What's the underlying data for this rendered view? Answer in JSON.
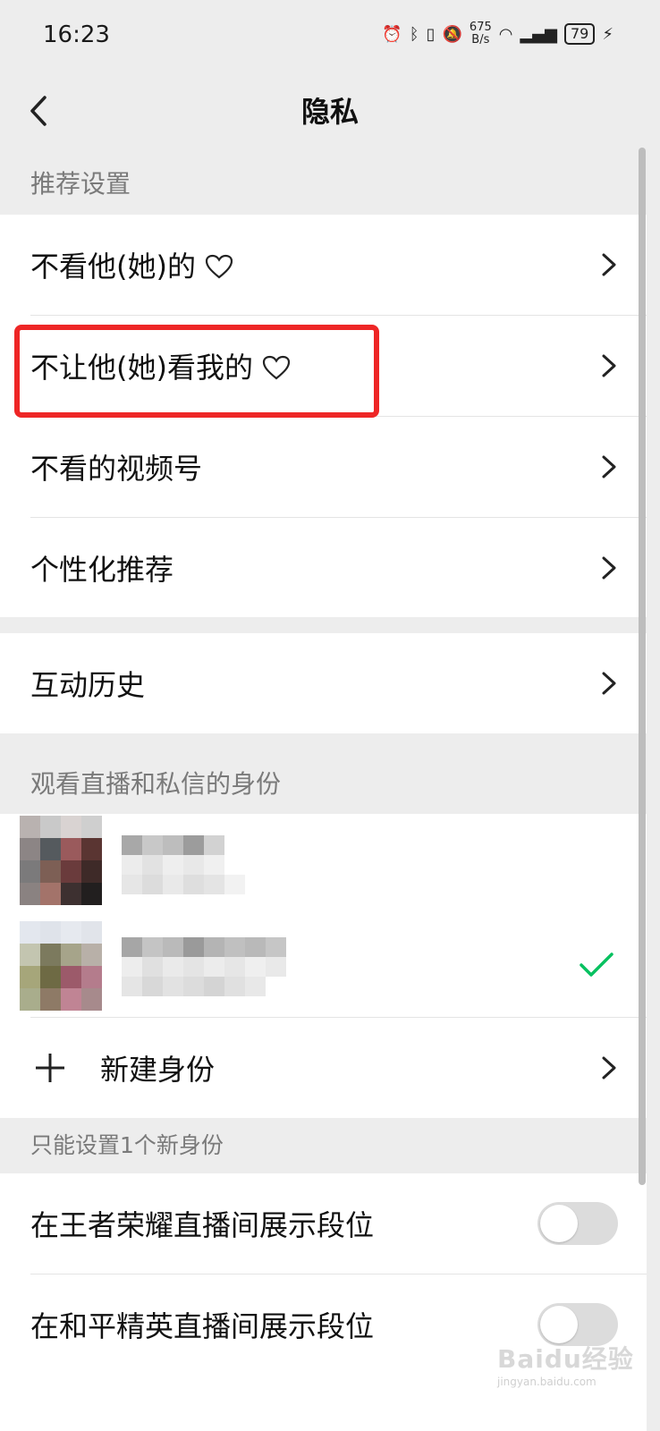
{
  "status_bar": {
    "time": "16:23",
    "net_speed_top": "675",
    "net_speed_bottom": "B/s",
    "battery": "79"
  },
  "nav": {
    "title": "隐私"
  },
  "recommend": {
    "header": "推荐设置",
    "items": [
      {
        "label": "不看他(她)的"
      },
      {
        "label": "不让他(她)看我的"
      },
      {
        "label": "不看的视频号"
      },
      {
        "label": "个性化推荐"
      }
    ]
  },
  "history": {
    "label": "互动历史"
  },
  "identity": {
    "header": "观看直播和私信的身份",
    "new_identity_label": "新建身份",
    "limit_note": "只能设置1个新身份"
  },
  "toggles": [
    {
      "label": "在王者荣耀直播间展示段位",
      "on": false
    },
    {
      "label": "在和平精英直播间展示段位",
      "on": false
    }
  ],
  "watermark": {
    "brand": "Baidu经验",
    "url": "jingyan.baidu.com"
  },
  "colors": {
    "accent_check": "#07c160",
    "highlight_box": "#ee2626"
  }
}
